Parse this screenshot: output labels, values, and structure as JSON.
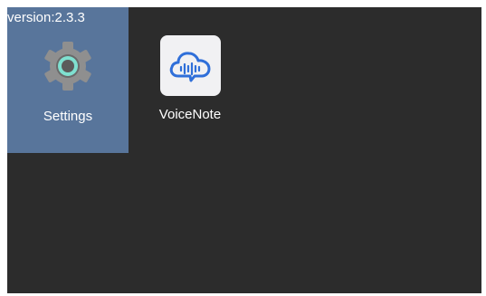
{
  "version_label": "version:2.3.3",
  "apps": [
    {
      "label": "Settings",
      "icon": "gear-icon"
    },
    {
      "label": "VoiceNote",
      "icon": "cloud-waveform-icon"
    }
  ],
  "colors": {
    "screen_bg": "#2c2c2c",
    "selected_tile": "#58759b",
    "voicenote_blue": "#2f6fd9",
    "gear_gray": "#8f8f8f",
    "gear_ring_teal": "#7fe0d0"
  }
}
